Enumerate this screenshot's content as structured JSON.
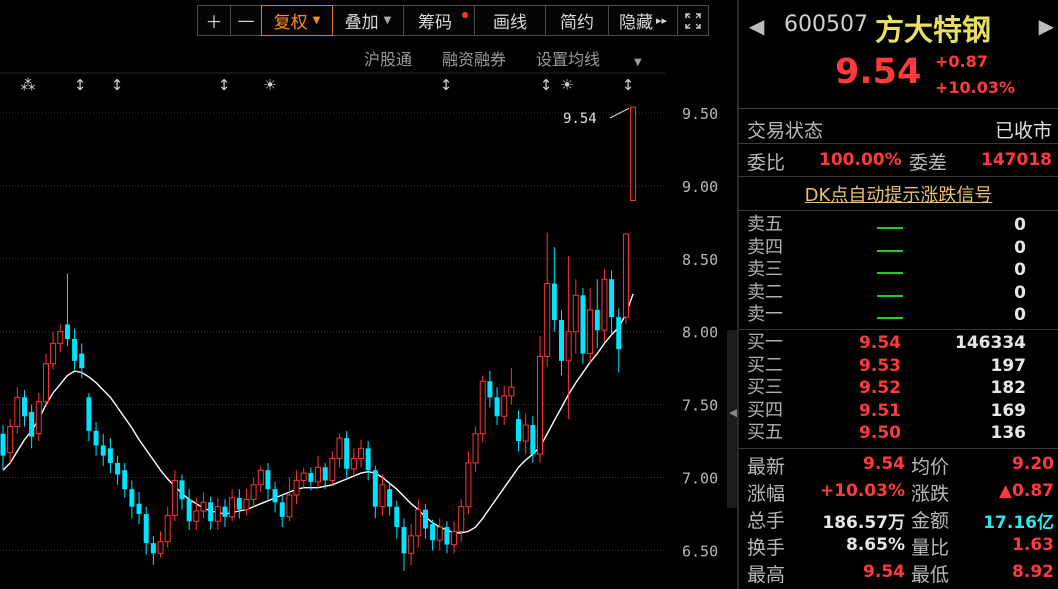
{
  "toolbar": {
    "zoom_in": "＋",
    "zoom_out": "—",
    "restore_rights": "复权",
    "overlay": "叠加",
    "chips": "筹码",
    "draw_line": "画线",
    "brief": "简约",
    "hide": "隐藏",
    "hide_arrow": "▸▸",
    "fullscreen_icon": "fullscreen-icon"
  },
  "subbar": {
    "hgt": "沪股通",
    "margin": "融资融券",
    "ma_setting": "设置均线"
  },
  "chart_data": {
    "type": "candlestick",
    "y_ticks": [
      "9.50",
      "9.00",
      "8.50",
      "8.00",
      "7.50",
      "7.00",
      "6.50"
    ],
    "last_price_label": "9.54",
    "event_marker_types": [
      "asterisk",
      "arrow",
      "arrow",
      "arrow",
      "sun",
      "arrow",
      "arrow",
      "sun",
      "arrow"
    ],
    "colors": {
      "up": "#ff3333",
      "down": "#00e5ff",
      "ma": "#ffffff"
    },
    "candles": [
      {
        "o": 7.3,
        "c": 7.15,
        "h": 7.36,
        "l": 7.05
      },
      {
        "o": 7.17,
        "c": 7.35,
        "h": 7.4,
        "l": 7.1
      },
      {
        "o": 7.35,
        "c": 7.55,
        "h": 7.62,
        "l": 7.3
      },
      {
        "o": 7.55,
        "c": 7.42,
        "h": 7.6,
        "l": 7.35
      },
      {
        "o": 7.45,
        "c": 7.28,
        "h": 7.5,
        "l": 7.2
      },
      {
        "o": 7.3,
        "c": 7.52,
        "h": 7.58,
        "l": 7.25
      },
      {
        "o": 7.52,
        "c": 7.78,
        "h": 7.85,
        "l": 7.5
      },
      {
        "o": 7.78,
        "c": 7.92,
        "h": 8.0,
        "l": 7.74
      },
      {
        "o": 7.92,
        "c": 8.0,
        "h": 8.05,
        "l": 7.86
      },
      {
        "o": 8.05,
        "c": 7.95,
        "h": 8.4,
        "l": 7.9
      },
      {
        "o": 7.95,
        "c": 7.8,
        "h": 8.02,
        "l": 7.74
      },
      {
        "o": 7.85,
        "c": 7.75,
        "h": 7.92,
        "l": 7.68
      },
      {
        "o": 7.55,
        "c": 7.32,
        "h": 7.58,
        "l": 7.25
      },
      {
        "o": 7.32,
        "c": 7.22,
        "h": 7.38,
        "l": 7.15
      },
      {
        "o": 7.22,
        "c": 7.15,
        "h": 7.3,
        "l": 7.08
      },
      {
        "o": 7.2,
        "c": 7.1,
        "h": 7.27,
        "l": 7.03
      },
      {
        "o": 7.1,
        "c": 7.02,
        "h": 7.15,
        "l": 6.95
      },
      {
        "o": 7.05,
        "c": 6.92,
        "h": 7.1,
        "l": 6.86
      },
      {
        "o": 6.92,
        "c": 6.8,
        "h": 6.98,
        "l": 6.72
      },
      {
        "o": 6.82,
        "c": 6.75,
        "h": 6.9,
        "l": 6.68
      },
      {
        "o": 6.75,
        "c": 6.55,
        "h": 6.8,
        "l": 6.47
      },
      {
        "o": 6.55,
        "c": 6.48,
        "h": 6.6,
        "l": 6.4
      },
      {
        "o": 6.48,
        "c": 6.56,
        "h": 6.63,
        "l": 6.45
      },
      {
        "o": 6.56,
        "c": 6.74,
        "h": 6.8,
        "l": 6.52
      },
      {
        "o": 6.74,
        "c": 6.98,
        "h": 7.05,
        "l": 6.7
      },
      {
        "o": 6.98,
        "c": 6.85,
        "h": 7.02,
        "l": 6.78
      },
      {
        "o": 6.85,
        "c": 6.7,
        "h": 6.92,
        "l": 6.64
      },
      {
        "o": 6.7,
        "c": 6.77,
        "h": 6.86,
        "l": 6.64
      },
      {
        "o": 6.77,
        "c": 6.83,
        "h": 6.9,
        "l": 6.72
      },
      {
        "o": 6.83,
        "c": 6.7,
        "h": 6.87,
        "l": 6.64
      },
      {
        "o": 6.7,
        "c": 6.8,
        "h": 6.86,
        "l": 6.64
      },
      {
        "o": 6.8,
        "c": 6.73,
        "h": 6.85,
        "l": 6.66
      },
      {
        "o": 6.73,
        "c": 6.86,
        "h": 6.92,
        "l": 6.7
      },
      {
        "o": 6.86,
        "c": 6.78,
        "h": 6.92,
        "l": 6.72
      },
      {
        "o": 6.78,
        "c": 6.85,
        "h": 6.92,
        "l": 6.74
      },
      {
        "o": 6.85,
        "c": 6.95,
        "h": 7.0,
        "l": 6.8
      },
      {
        "o": 6.95,
        "c": 7.05,
        "h": 7.08,
        "l": 6.9
      },
      {
        "o": 7.05,
        "c": 6.92,
        "h": 7.1,
        "l": 6.85
      },
      {
        "o": 6.92,
        "c": 6.83,
        "h": 6.97,
        "l": 6.76
      },
      {
        "o": 6.83,
        "c": 6.73,
        "h": 6.88,
        "l": 6.66
      },
      {
        "o": 6.73,
        "c": 6.88,
        "h": 7.0,
        "l": 6.7
      },
      {
        "o": 6.88,
        "c": 6.98,
        "h": 7.05,
        "l": 6.82
      },
      {
        "o": 6.98,
        "c": 7.03,
        "h": 7.07,
        "l": 6.93
      },
      {
        "o": 7.03,
        "c": 6.97,
        "h": 7.07,
        "l": 6.91
      },
      {
        "o": 6.97,
        "c": 7.07,
        "h": 7.15,
        "l": 6.93
      },
      {
        "o": 7.07,
        "c": 6.98,
        "h": 7.1,
        "l": 6.92
      },
      {
        "o": 6.98,
        "c": 7.13,
        "h": 7.18,
        "l": 6.95
      },
      {
        "o": 7.13,
        "c": 7.27,
        "h": 7.3,
        "l": 7.07
      },
      {
        "o": 7.27,
        "c": 7.06,
        "h": 7.32,
        "l": 7.0
      },
      {
        "o": 7.06,
        "c": 7.13,
        "h": 7.2,
        "l": 7.01
      },
      {
        "o": 7.13,
        "c": 7.2,
        "h": 7.26,
        "l": 7.07
      },
      {
        "o": 7.2,
        "c": 7.05,
        "h": 7.25,
        "l": 6.98
      },
      {
        "o": 7.05,
        "c": 6.8,
        "h": 7.08,
        "l": 6.72
      },
      {
        "o": 6.8,
        "c": 6.95,
        "h": 7.02,
        "l": 6.74
      },
      {
        "o": 6.92,
        "c": 6.8,
        "h": 6.96,
        "l": 6.74
      },
      {
        "o": 6.8,
        "c": 6.66,
        "h": 6.84,
        "l": 6.58
      },
      {
        "o": 6.66,
        "c": 6.48,
        "h": 6.72,
        "l": 6.36
      },
      {
        "o": 6.48,
        "c": 6.6,
        "h": 6.68,
        "l": 6.4
      },
      {
        "o": 6.6,
        "c": 6.78,
        "h": 6.85,
        "l": 6.52
      },
      {
        "o": 6.78,
        "c": 6.65,
        "h": 6.82,
        "l": 6.58
      },
      {
        "o": 6.68,
        "c": 6.57,
        "h": 6.71,
        "l": 6.5
      },
      {
        "o": 6.57,
        "c": 6.66,
        "h": 6.72,
        "l": 6.5
      },
      {
        "o": 6.66,
        "c": 6.54,
        "h": 6.7,
        "l": 6.48
      },
      {
        "o": 6.54,
        "c": 6.63,
        "h": 6.7,
        "l": 6.48
      },
      {
        "o": 6.63,
        "c": 6.8,
        "h": 6.85,
        "l": 6.56
      },
      {
        "o": 6.8,
        "c": 7.1,
        "h": 7.18,
        "l": 6.75
      },
      {
        "o": 7.1,
        "c": 7.3,
        "h": 7.35,
        "l": 7.04
      },
      {
        "o": 7.3,
        "c": 7.66,
        "h": 7.7,
        "l": 7.24
      },
      {
        "o": 7.66,
        "c": 7.55,
        "h": 7.73,
        "l": 7.48
      },
      {
        "o": 7.55,
        "c": 7.42,
        "h": 7.62,
        "l": 7.36
      },
      {
        "o": 7.42,
        "c": 7.56,
        "h": 7.63,
        "l": 7.36
      },
      {
        "o": 7.56,
        "c": 7.62,
        "h": 7.75,
        "l": 7.5
      },
      {
        "o": 7.4,
        "c": 7.25,
        "h": 7.46,
        "l": 7.18
      },
      {
        "o": 7.25,
        "c": 7.36,
        "h": 7.44,
        "l": 7.16
      },
      {
        "o": 7.36,
        "c": 7.16,
        "h": 7.42,
        "l": 7.1
      },
      {
        "o": 7.16,
        "c": 7.83,
        "h": 7.97,
        "l": 7.1
      },
      {
        "o": 7.83,
        "c": 8.33,
        "h": 8.68,
        "l": 7.76
      },
      {
        "o": 8.33,
        "c": 8.08,
        "h": 8.58,
        "l": 8.0
      },
      {
        "o": 8.08,
        "c": 7.8,
        "h": 8.15,
        "l": 7.7
      },
      {
        "o": 7.8,
        "c": 8.0,
        "h": 8.52,
        "l": 7.4
      },
      {
        "o": 8.0,
        "c": 8.25,
        "h": 8.36,
        "l": 7.85
      },
      {
        "o": 8.25,
        "c": 7.85,
        "h": 8.3,
        "l": 7.78
      },
      {
        "o": 7.85,
        "c": 8.15,
        "h": 8.3,
        "l": 7.78
      },
      {
        "o": 8.15,
        "c": 8.01,
        "h": 8.36,
        "l": 7.89
      },
      {
        "o": 8.01,
        "c": 8.36,
        "h": 8.43,
        "l": 7.93
      },
      {
        "o": 8.36,
        "c": 8.1,
        "h": 8.42,
        "l": 7.98
      },
      {
        "o": 8.1,
        "c": 7.88,
        "h": 8.16,
        "l": 7.72
      },
      {
        "o": 8.1,
        "c": 8.67,
        "h": 8.67,
        "l": 8.05
      },
      {
        "o": 8.9,
        "c": 9.54,
        "h": 9.54,
        "l": 8.9
      }
    ],
    "ma": [
      7.05,
      7.1,
      7.18,
      7.26,
      7.32,
      7.4,
      7.5,
      7.58,
      7.64,
      7.7,
      7.73,
      7.72,
      7.69,
      7.65,
      7.6,
      7.55,
      7.48,
      7.41,
      7.34,
      7.26,
      7.19,
      7.12,
      7.05,
      6.99,
      6.94,
      6.89,
      6.85,
      6.82,
      6.79,
      6.77,
      6.76,
      6.75,
      6.76,
      6.77,
      6.78,
      6.8,
      6.82,
      6.84,
      6.86,
      6.88,
      6.9,
      6.92,
      6.93,
      6.93,
      6.93,
      6.94,
      6.95,
      6.97,
      6.99,
      7.01,
      7.03,
      7.04,
      7.03,
      7.0,
      6.96,
      6.92,
      6.87,
      6.82,
      6.78,
      6.73,
      6.69,
      6.66,
      6.64,
      6.62,
      6.62,
      6.63,
      6.66,
      6.72,
      6.79,
      6.86,
      6.93,
      7.0,
      7.07,
      7.12,
      7.16,
      7.21,
      7.3,
      7.39,
      7.48,
      7.57,
      7.65,
      7.72,
      7.79,
      7.85,
      7.92,
      7.98,
      8.03,
      8.12,
      8.26
    ]
  },
  "panel": {
    "code": "600507",
    "name": "方大特钢",
    "price": "9.54",
    "change": "+0.87",
    "change_pct": "+10.03%",
    "trade_status_label": "交易状态",
    "trade_status_value": "已收市",
    "commit_ratio_label": "委比",
    "commit_ratio_value": "100.00%",
    "commit_diff_label": "委差",
    "commit_diff_value": "147018",
    "dk_signal": "DK点自动提示涨跌信号",
    "asks": [
      {
        "label": "卖五",
        "price": "—",
        "vol": "0"
      },
      {
        "label": "卖四",
        "price": "—",
        "vol": "0"
      },
      {
        "label": "卖三",
        "price": "—",
        "vol": "0"
      },
      {
        "label": "卖二",
        "price": "—",
        "vol": "0"
      },
      {
        "label": "卖一",
        "price": "—",
        "vol": "0"
      }
    ],
    "bids": [
      {
        "label": "买一",
        "price": "9.54",
        "vol": "146334"
      },
      {
        "label": "买二",
        "price": "9.53",
        "vol": "197"
      },
      {
        "label": "买三",
        "price": "9.52",
        "vol": "182"
      },
      {
        "label": "买四",
        "price": "9.51",
        "vol": "169"
      },
      {
        "label": "买五",
        "price": "9.50",
        "vol": "136"
      }
    ],
    "stats": [
      {
        "l1": "最新",
        "v1": "9.54",
        "c1": "red",
        "l2": "均价",
        "v2": "9.20",
        "c2": "red"
      },
      {
        "l1": "涨幅",
        "v1": "+10.03%",
        "c1": "red",
        "l2": "涨跌",
        "v2": "▲0.87",
        "c2": "red"
      },
      {
        "l1": "总手",
        "v1": "186.57万",
        "c1": "white",
        "l2": "金额",
        "v2": "17.16亿",
        "c2": "cyan"
      },
      {
        "l1": "换手",
        "v1": "8.65%",
        "c1": "white",
        "l2": "量比",
        "v2": "1.63",
        "c2": "red"
      },
      {
        "l1": "最高",
        "v1": "9.54",
        "c1": "red",
        "l2": "最低",
        "v2": "8.92",
        "c2": "red"
      }
    ]
  }
}
